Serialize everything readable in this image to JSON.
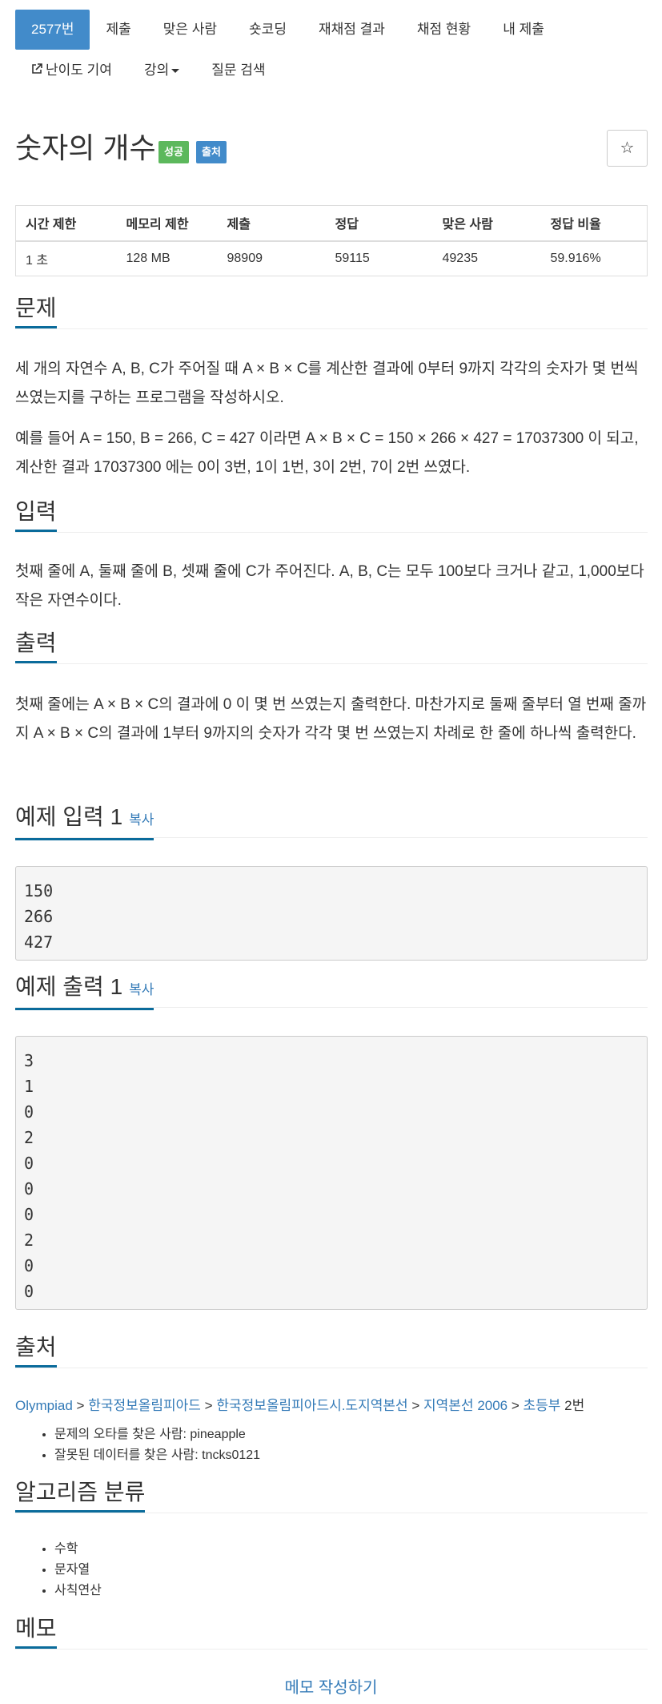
{
  "nav": {
    "row1": [
      "2577번",
      "제출",
      "맞은 사람",
      "숏코딩",
      "재채점 결과",
      "채점 현황",
      "내 제출"
    ],
    "row2": {
      "contribute": "난이도 기여",
      "lecture": "강의",
      "question": "질문 검색"
    }
  },
  "problem": {
    "title": "숫자의 개수",
    "badge_success": "성공",
    "badge_source": "출처",
    "star": "☆"
  },
  "info_table": {
    "headers": [
      "시간 제한",
      "메모리 제한",
      "제출",
      "정답",
      "맞은 사람",
      "정답 비율"
    ],
    "values": [
      "1 초",
      "128 MB",
      "98909",
      "59115",
      "49235",
      "59.916%"
    ]
  },
  "sections": {
    "problem_head": "문제",
    "problem_p1": "세 개의 자연수 A, B, C가 주어질 때 A × B × C를 계산한 결과에 0부터 9까지 각각의 숫자가 몇 번씩 쓰였는지를 구하는 프로그램을 작성하시오.",
    "problem_p2": "예를 들어 A = 150, B = 266, C = 427 이라면 A × B × C = 150 × 266 × 427 = 17037300 이 되고, 계산한 결과 17037300 에는 0이 3번, 1이 1번, 3이 2번, 7이 2번 쓰였다.",
    "input_head": "입력",
    "input_p": "첫째 줄에 A, 둘째 줄에 B, 셋째 줄에 C가 주어진다. A, B, C는 모두 100보다 크거나 같고, 1,000보다 작은 자연수이다.",
    "output_head": "출력",
    "output_p": "첫째 줄에는 A × B × C의 결과에 0 이 몇 번 쓰였는지 출력한다. 마찬가지로 둘째 줄부터 열 번째 줄까지 A × B × C의 결과에 1부터 9까지의 숫자가 각각 몇 번 쓰였는지 차례로 한 줄에 하나씩 출력한다.",
    "sample_input_head": "예제 입력 1",
    "sample_output_head": "예제 출력 1",
    "copy": "복사",
    "sample_input": "150\n266\n427",
    "sample_output": "3\n1\n0\n2\n0\n0\n0\n2\n0\n0",
    "source_head": "출처",
    "algo_head": "알고리즘 분류",
    "memo_head": "메모"
  },
  "source": {
    "crumbs": [
      "Olympiad",
      "한국정보올림피아드",
      "한국정보올림피아드시.도지역본선",
      "지역본선 2006"
    ],
    "last": "초등부",
    "last_suffix": " 2번",
    "separator": " > ",
    "credits": [
      "문제의 오타를 찾은 사람: pineapple",
      "잘못된 데이터를 찾은 사람: tncks0121"
    ]
  },
  "algorithms": [
    "수학",
    "문자열",
    "사칙연산"
  ],
  "memo_button": "메모 작성하기"
}
